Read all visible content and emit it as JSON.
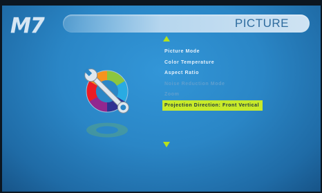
{
  "brand": {
    "logo": "M7"
  },
  "header": {
    "title": "PICTURE"
  },
  "menu": {
    "items": [
      {
        "label": "Picture Mode",
        "state": "normal"
      },
      {
        "label": "Color Temperature",
        "state": "normal"
      },
      {
        "label": "Aspect Ratio",
        "state": "normal"
      },
      {
        "label": "Noise Reduction Mode",
        "state": "disabled"
      },
      {
        "label": "Zoom",
        "state": "disabled"
      },
      {
        "label": "Projection Direction: Front Vertical",
        "state": "selected"
      }
    ]
  },
  "icons": {
    "scroll_up": "triangle-up-icon",
    "scroll_down": "triangle-down-icon",
    "settings": "color-wheel-wrench-icon"
  },
  "colors": {
    "accent": "#c8ea2a",
    "background": "#2a86c6",
    "title_text": "#2f6c9e"
  }
}
